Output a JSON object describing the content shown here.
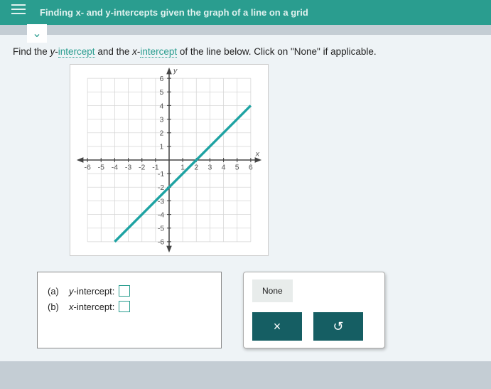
{
  "header": {
    "title": "Finding x- and y-intercepts given the graph of a line on a grid"
  },
  "instruction": {
    "prefix": "Find the ",
    "y_label": "y",
    "dash1": "-",
    "link1": "intercept",
    "mid": " and the ",
    "x_label": "x",
    "dash2": "-",
    "link2": "intercept",
    "suffix": " of the line below. Click on \"None\" if applicable."
  },
  "answers": {
    "a_prefix": "(a)",
    "a_label_pre": " y",
    "a_label_post": "-intercept:",
    "b_prefix": "(b)",
    "b_label_pre": " x",
    "b_label_post": "-intercept:"
  },
  "buttons": {
    "none": "None",
    "close": "×",
    "reset": "↺"
  },
  "chart_data": {
    "type": "line",
    "title": "",
    "xlabel": "x",
    "ylabel": "y",
    "xlim": [
      -6,
      6
    ],
    "ylim": [
      -6,
      6
    ],
    "series": [
      {
        "name": "line",
        "points": [
          [
            -4,
            -6
          ],
          [
            6,
            4
          ]
        ]
      }
    ],
    "intercepts": {
      "x_intercept": 2,
      "y_intercept": -2
    }
  }
}
